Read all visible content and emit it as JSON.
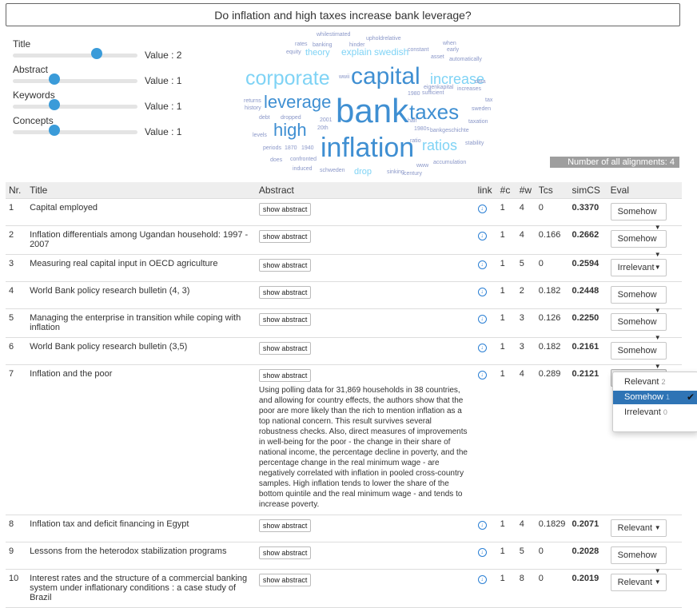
{
  "query": "Do inflation and high taxes increase bank leverage?",
  "sliders": [
    {
      "label": "Title",
      "value_text": "Value : 2",
      "value": 2
    },
    {
      "label": "Abstract",
      "value_text": "Value : 1",
      "value": 1
    },
    {
      "label": "Keywords",
      "value_text": "Value : 1",
      "value": 1
    },
    {
      "label": "Concepts",
      "value_text": "Value : 1",
      "value": 1
    }
  ],
  "word_cloud": [
    "whilestimated",
    "upholdrelative",
    "when",
    "rates",
    "banking",
    "hinder",
    "early",
    "equity",
    "theory",
    "explain",
    "swedish",
    "constant",
    "asset",
    "automatically",
    "corporate",
    "wwii",
    "capital",
    "increase",
    "data",
    "eigenkapital",
    "increases",
    "1980",
    "sufficient",
    "returns",
    "leverage",
    "bank",
    "taxes",
    "tax",
    "history",
    "sweden",
    "debt",
    "dropped",
    "2001",
    "half",
    "taxation",
    "20th",
    "high",
    "1980s",
    "bankgeschichte",
    "levels",
    "inflation",
    "ratio",
    "ratios",
    "stability",
    "periods",
    "1870",
    "1940",
    "does",
    "confronted",
    "induced",
    "schweden",
    "drop",
    "sinking",
    "century",
    "www",
    "accumulation"
  ],
  "alignments_label": "Number of all alignments: 4",
  "columns": [
    "Nr.",
    "Title",
    "Abstract",
    "link",
    "#c",
    "#w",
    "Tcs",
    "simCS",
    "Eval"
  ],
  "show_abstract_label": "show abstract",
  "rows": [
    {
      "nr": "1",
      "title": "Capital employed",
      "c": "1",
      "w": "4",
      "tcs": "0",
      "sim": "0.3370",
      "eval": "Somehow"
    },
    {
      "nr": "2",
      "title": "Inflation differentials among Ugandan household: 1997 - 2007",
      "c": "1",
      "w": "4",
      "tcs": "0.166",
      "sim": "0.2662",
      "eval": "Somehow"
    },
    {
      "nr": "3",
      "title": "Measuring real capital input in OECD agriculture",
      "c": "1",
      "w": "5",
      "tcs": "0",
      "sim": "0.2594",
      "eval": "Irrelevant"
    },
    {
      "nr": "4",
      "title": "World Bank policy research bulletin (4, 3)",
      "c": "1",
      "w": "2",
      "tcs": "0.182",
      "sim": "0.2448",
      "eval": "Somehow"
    },
    {
      "nr": "5",
      "title": "Managing the enterprise in transition while coping with inflation",
      "c": "1",
      "w": "3",
      "tcs": "0.126",
      "sim": "0.2250",
      "eval": "Somehow"
    },
    {
      "nr": "6",
      "title": "World Bank policy research bulletin (3,5)",
      "c": "1",
      "w": "3",
      "tcs": "0.182",
      "sim": "0.2161",
      "eval": "Somehow"
    },
    {
      "nr": "7",
      "title": "Inflation and the poor",
      "c": "1",
      "w": "4",
      "tcs": "0.289",
      "sim": "0.2121",
      "eval": "Somehow",
      "abstract": "Using polling data for 31,869 households in 38 countries, and allowing for country effects, the authors show that the poor are more likely than the rich to mention inflation as a top national concern. This result survives several robustness checks. Also, direct measures of improvements in well-being for the poor - the change in their share of national income, the percentage decline in poverty, and the percentage change in the real minimum wage - are negatively correlated with inflation in pooled cross-country samples. High inflation tends to lower the share of the bottom quintile and the real minimum wage - and tends to increase poverty."
    },
    {
      "nr": "8",
      "title": "Inflation tax and deficit financing in Egypt",
      "c": "1",
      "w": "4",
      "tcs": "0.1829",
      "sim": "0.2071",
      "eval": "Relevant"
    },
    {
      "nr": "9",
      "title": "Lessons from the heterodox stabilization programs",
      "c": "1",
      "w": "5",
      "tcs": "0",
      "sim": "0.2028",
      "eval": "Somehow"
    },
    {
      "nr": "10",
      "title": "Interest rates and the structure of a commercial banking system under inflationary conditions : a case study of Brazil",
      "c": "1",
      "w": "8",
      "tcs": "0",
      "sim": "0.2019",
      "eval": "Relevant"
    }
  ],
  "dropdown": {
    "items": [
      {
        "label": "Relevant",
        "count": "2"
      },
      {
        "label": "Somehow",
        "count": "1"
      },
      {
        "label": "Irrelevant",
        "count": "0"
      }
    ]
  },
  "colors": {
    "accent": "#3a9bd9",
    "selected": "#2f74b5",
    "cloud_dark": "#3f8fd2",
    "cloud_light": "#7fd3f5",
    "cloud_gray": "#8a97c8"
  }
}
